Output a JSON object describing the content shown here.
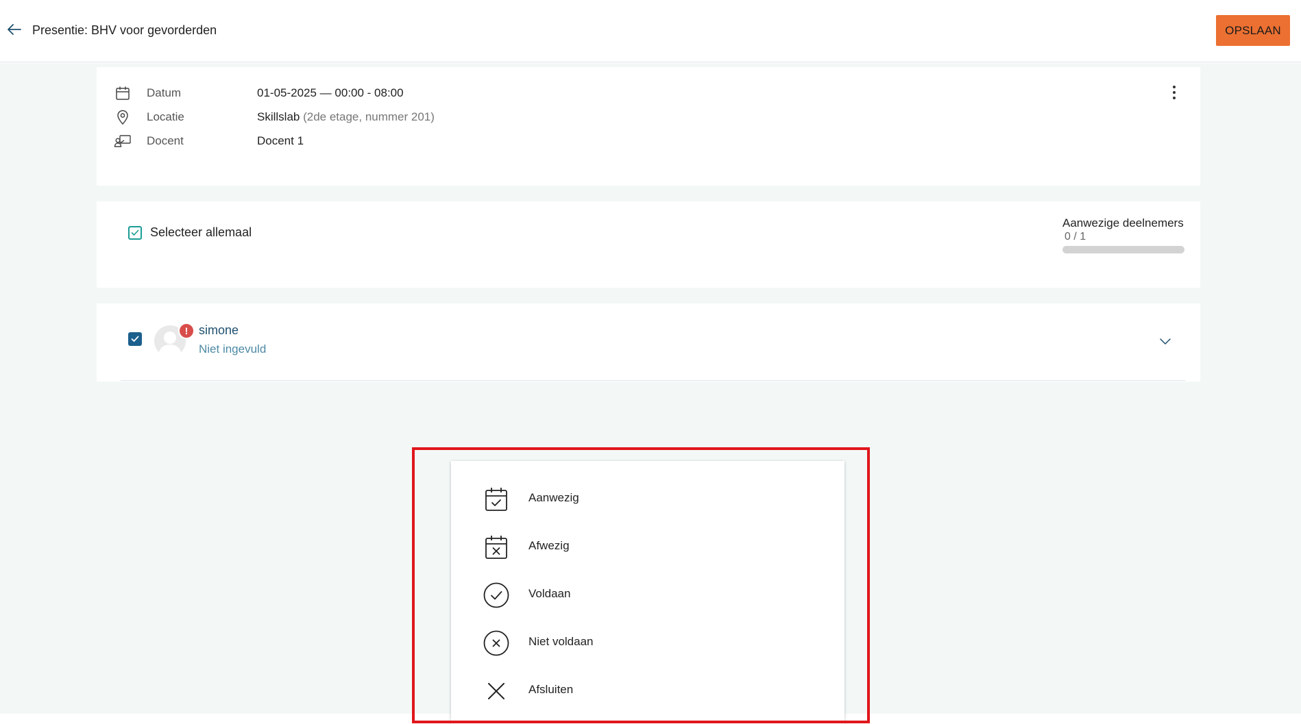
{
  "header": {
    "title": "Presentie: BHV voor gevorderden",
    "save_label": "OPSLAAN"
  },
  "info": {
    "date_label": "Datum",
    "date_value": "01-05-2025 — 00:00 - 08:00",
    "location_label": "Locatie",
    "location_value": "Skillslab",
    "location_detail": "(2de etage, nummer 201)",
    "teacher_label": "Docent",
    "teacher_value": "Docent 1"
  },
  "selection": {
    "select_all_label": "Selecteer allemaal",
    "attendance_title": "Aanwezige deelnemers",
    "attendance_count": "0 / 1",
    "attendance_fraction": 0
  },
  "participants": [
    {
      "name": "simone",
      "status": "Niet ingevuld",
      "checked": true,
      "alert_badge": "!"
    }
  ],
  "menu": {
    "items": [
      {
        "label": "Aanwezig",
        "icon": "calendar-check-icon"
      },
      {
        "label": "Afwezig",
        "icon": "calendar-x-icon"
      },
      {
        "label": "Voldaan",
        "icon": "circle-check-icon"
      },
      {
        "label": "Niet voldaan",
        "icon": "circle-x-icon"
      },
      {
        "label": "Afsluiten",
        "icon": "close-icon"
      }
    ]
  },
  "colors": {
    "accent_orange": "#ec7031",
    "teal": "#1a9c94",
    "navy": "#1b5f8c",
    "alert_red": "#d84d4a",
    "highlight_red": "#e0171c",
    "background": "#f3f8f7"
  }
}
